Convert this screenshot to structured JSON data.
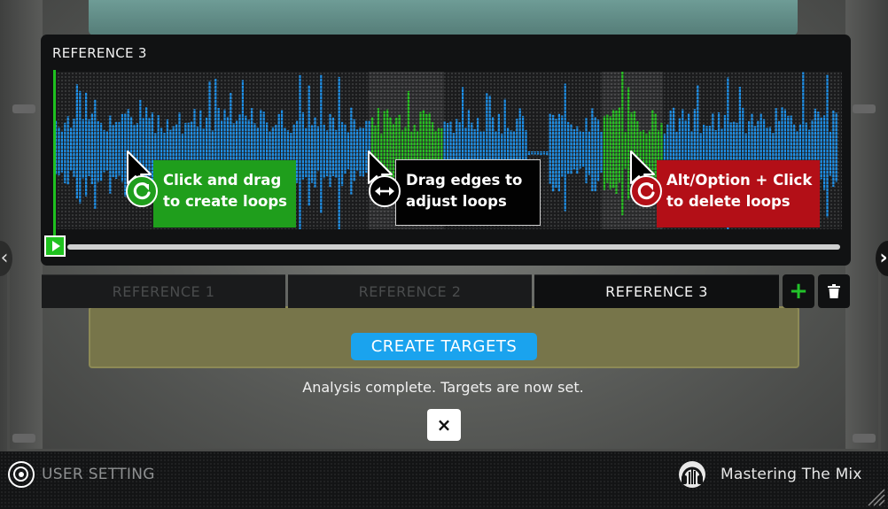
{
  "panel": {
    "title": "REFERENCE 3"
  },
  "tooltips": {
    "create_loops": {
      "line1": "Click and drag",
      "line2": "to create loops"
    },
    "adjust_loops": {
      "line1": "Drag edges to",
      "line2": "adjust loops"
    },
    "delete_loops": {
      "line1": "Alt/Option + Click",
      "line2": "to delete loops"
    }
  },
  "tabs": [
    {
      "label": "REFERENCE 1",
      "active": false
    },
    {
      "label": "REFERENCE 2",
      "active": false
    },
    {
      "label": "REFERENCE 3",
      "active": true
    }
  ],
  "actions": {
    "add_symbol": "+",
    "create_targets_label": "CREATE TARGETS",
    "status": "Analysis complete. Targets are now set.",
    "close_symbol": "×"
  },
  "footer": {
    "user_setting_label": "USER SETTING",
    "brand_label": "Mastering The Mix"
  },
  "colors": {
    "waveform_blue": "#1e8fe6",
    "loop_green": "#27c221",
    "create_tip": "#1f9e1c",
    "delete_tip": "#b30f17",
    "create_button": "#1aa3ee",
    "playhead": "#1fc11f"
  },
  "loops": [
    {
      "start": 0.4,
      "end": 0.495
    },
    {
      "start": 0.695,
      "end": 0.773
    }
  ],
  "icons": {
    "create_tip": "rotate-arrow-icon",
    "adjust_tip": "horizontal-resize-icon",
    "delete_tip": "rotate-arrow-icon",
    "delete_button": "trash-icon",
    "user_setting": "target-icon",
    "brand": "headphones-logo-icon"
  }
}
